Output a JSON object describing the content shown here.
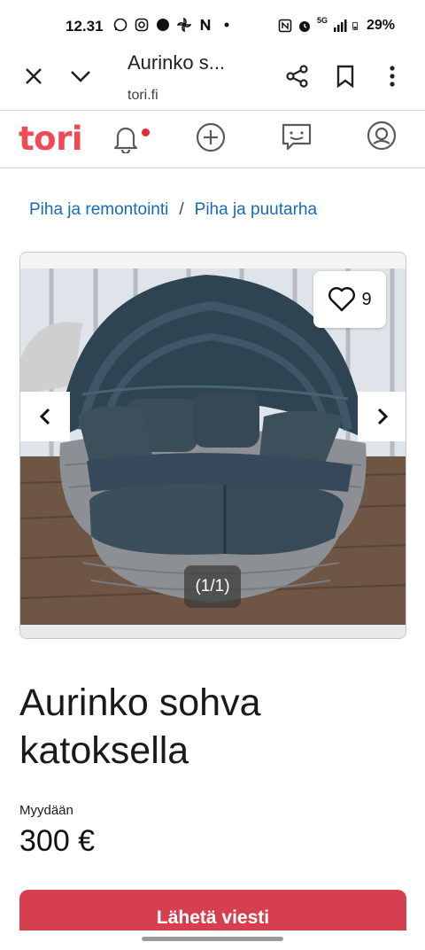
{
  "status_bar": {
    "time": "12.31",
    "battery": "29%",
    "network": "5G"
  },
  "browser": {
    "title": "Aurinko s...",
    "url": "tori.fi",
    "icons": [
      "close-icon",
      "chevron-down-icon",
      "share-icon",
      "bookmark-icon",
      "more-vert-icon"
    ]
  },
  "nav": {
    "logo": "tori",
    "icons": [
      "bell-icon",
      "add-circle-icon",
      "chat-icon",
      "profile-icon"
    ],
    "accent_color": "#ef4a55"
  },
  "breadcrumb": {
    "items": [
      "Piha ja remontointi",
      "Piha ja puutarha"
    ],
    "separator": "/"
  },
  "gallery": {
    "favorites_count": "9",
    "counter": "(1/1)"
  },
  "listing": {
    "title": "Aurinko sohva katoksella",
    "type_label": "Myydään",
    "price": "300 €"
  },
  "actions": {
    "send_message": "Lähetä viesti",
    "button_color": "#d63f4f"
  }
}
